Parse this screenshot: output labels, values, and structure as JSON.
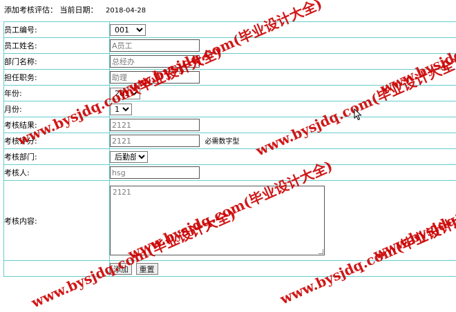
{
  "header": {
    "title": "添加考核评估：",
    "date_label": "当前日期：",
    "date_value": "2018-04-28"
  },
  "form": {
    "rows": {
      "employee_id": {
        "label": "员工编号:",
        "value": "001"
      },
      "employee_name": {
        "label": "员工姓名:",
        "value": "A员工"
      },
      "department": {
        "label": "部门名称:",
        "value": "总经办"
      },
      "position": {
        "label": "担任职务:",
        "value": "助理"
      },
      "year": {
        "label": "年份:",
        "value": "2018"
      },
      "month": {
        "label": "月份:",
        "value": "1"
      },
      "result": {
        "label": "考核结果:",
        "value": "2121"
      },
      "score": {
        "label": "考核评分:",
        "value": "2121",
        "note": "必需数字型"
      },
      "assess_dept": {
        "label": "考核部门:",
        "value": "后勤部"
      },
      "assessor": {
        "label": "考核人:",
        "value": "hsg"
      },
      "content": {
        "label": "考核内容:",
        "value": "2121"
      }
    },
    "buttons": {
      "add": "添加",
      "reset": "重置"
    }
  },
  "watermark": {
    "text": "www.bysjdq.com(毕业设计大全)",
    "color": "#cc0000"
  },
  "icons": [
    "dropdown-arrow-icon",
    "mouse-cursor-icon"
  ]
}
